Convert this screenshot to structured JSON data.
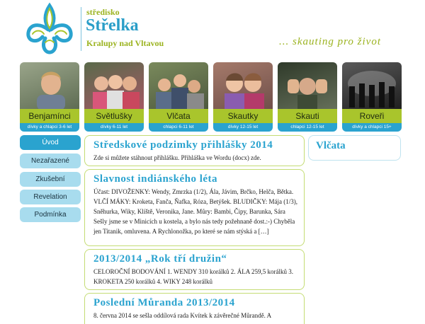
{
  "header": {
    "brand_pre": "středisko",
    "brand_name": "Střelka",
    "brand_sub": "Kralupy nad Vltavou",
    "tagline": "... skauting pro život"
  },
  "categories": [
    {
      "label": "Benjamínci",
      "sub": "dívky a chlapci 3-6 let",
      "photo_color": "#7b8a6e"
    },
    {
      "label": "Světlušky",
      "sub": "dívky 6-11 let",
      "photo_color": "#b86a78"
    },
    {
      "label": "Vlčata",
      "sub": "chlapci 6-11 let",
      "photo_color": "#6d7a5c"
    },
    {
      "label": "Skautky",
      "sub": "dívky 12-15 let",
      "photo_color": "#8e6a64"
    },
    {
      "label": "Skauti",
      "sub": "chlapci 12-15 let",
      "photo_color": "#4e5a48"
    },
    {
      "label": "Roveři",
      "sub": "dívky a chlapci 15+",
      "photo_color": "#3a3a3a"
    }
  ],
  "nav": [
    {
      "label": "Úvod",
      "active": true
    },
    {
      "label": "Nezařazené",
      "active": false
    },
    {
      "label": "Zkušební",
      "active": false
    },
    {
      "label": "Revelation",
      "active": false
    },
    {
      "label": "Podmínka",
      "active": false
    }
  ],
  "posts": [
    {
      "title": "Středskové podzimky přihlášky 2014",
      "body": "Zde si můžete stáhnout přihlášku. Přihláška ve Wordu (docx) zde."
    },
    {
      "title": "Slavnost indiánského léta",
      "body": "Účast: DIVOŽENKY: Wendy, Zmrzka (1/2), Ála, Jávim, Brčko, Helča, Bětka. VLČÍ MÁKY: Kroketa, Fanča, Ňafka, Róza, Betýšek. BLUDIČKY: Mája (1/3), Sněhurka, Wiky, Klíště, Veronika, Jane. Můry: Bambi, Čipy, Barunka, Sára Sešly jsme se v Minicích u kostela, a bylo nás tedy požehnaně dost.:-) Chyběla jen Titanik, omluvena. A Rychlonožka, po které se nám stýská a […]"
    },
    {
      "title": "2013/2014 „Rok tří družin“",
      "body": "CELOROČNÍ BODOVÁNÍ 1. WENDY   310 korálků 2. ÁLA   259,5 korálků 3. KROKETA   250 korálků 4. WIKY 248 korálků"
    },
    {
      "title": "Poslední Můranda 2013/2014",
      "body": "8. června 2014 se sešla oddílová rada Kvítek k závěrečné Můrandě. A"
    }
  ],
  "sidebar": {
    "title": "Vlčata"
  },
  "colors": {
    "accent_blue": "#2aa3cf",
    "accent_green": "#a9c52c",
    "nav_light": "#a8dcee"
  }
}
